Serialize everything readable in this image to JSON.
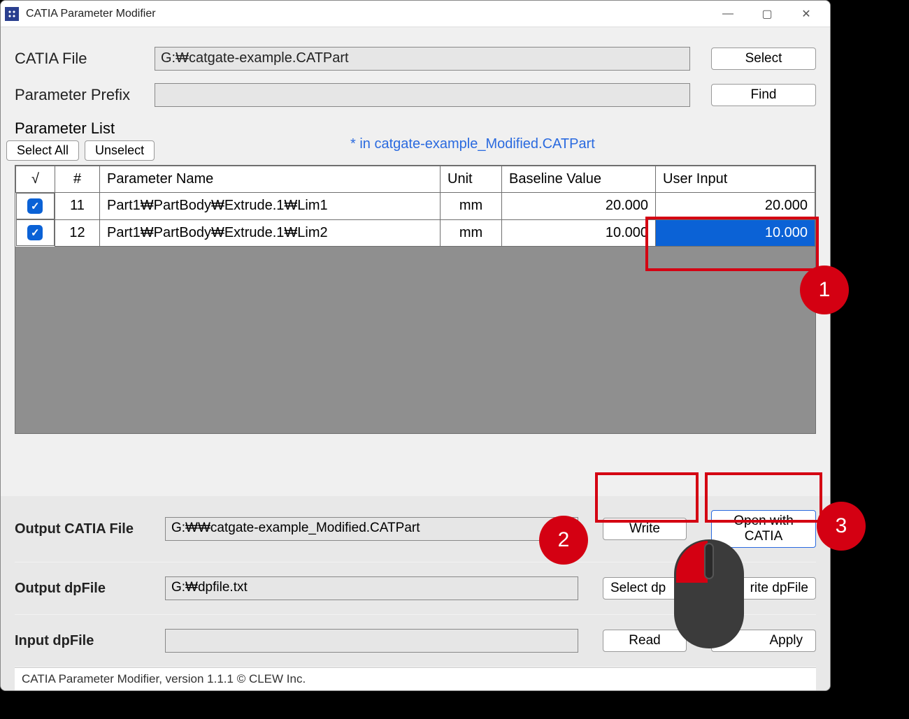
{
  "window": {
    "title": "CATIA Parameter Modifier"
  },
  "labels": {
    "catia_file": "CATIA File",
    "param_prefix": "Parameter Prefix",
    "param_list": "Parameter List",
    "select_btn": "Select",
    "find_btn": "Find",
    "select_all": "Select All",
    "unselect": "Unselect",
    "output_catia": "Output CATIA File",
    "output_dp": "Output dpFile",
    "input_dp": "Input dpFile",
    "write_btn": "Write",
    "open_catia_btn": "Open with CATIA",
    "select_dp_btn": "Select dp",
    "write_dp_btn": "rite dpFile",
    "read_btn": "Read",
    "apply_btn": "Apply"
  },
  "fields": {
    "catia_file": "G:₩catgate-example.CATPart",
    "param_prefix": "",
    "output_catia": "G:₩₩catgate-example_Modified.CATPart",
    "output_dp": "G:₩dpfile.txt",
    "input_dp": ""
  },
  "hint": "*  in   catgate-example_Modified.CATPart",
  "table": {
    "headers": {
      "check": "√",
      "idx": "#",
      "name": "Parameter Name",
      "unit": "Unit",
      "baseline": "Baseline Value",
      "userinput": "User Input"
    },
    "rows": [
      {
        "checked": true,
        "idx": "11",
        "name": "Part1₩PartBody₩Extrude.1₩Lim1",
        "unit": "mm",
        "baseline": "20.000",
        "userinput": "20.000",
        "selected": false
      },
      {
        "checked": true,
        "idx": "12",
        "name": "Part1₩PartBody₩Extrude.1₩Lim2",
        "unit": "mm",
        "baseline": "10.000",
        "userinput": "10.000",
        "selected": true
      }
    ]
  },
  "status": "CATIA Parameter Modifier, version 1.1.1 © CLEW Inc.",
  "annotations": {
    "a1": "1",
    "a2": "2",
    "a3": "3"
  }
}
